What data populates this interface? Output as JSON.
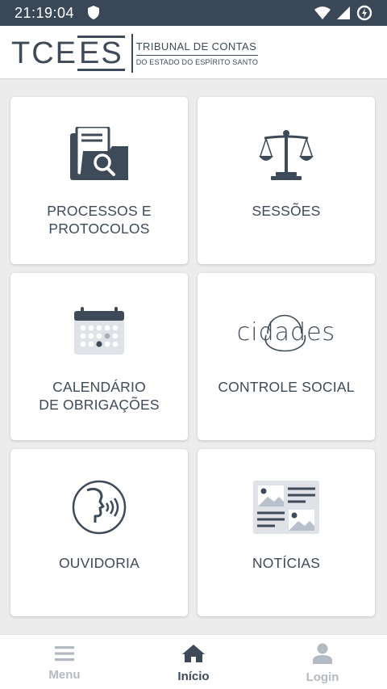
{
  "status_bar": {
    "time": "21:19:04"
  },
  "header": {
    "logo_mark_left": "TCE",
    "logo_mark_right": "ES",
    "logo_line1": "TRIBUNAL DE CONTAS",
    "logo_line2": "DO ESTADO DO ESPÍRITO SANTO"
  },
  "tiles": [
    {
      "label": "PROCESSOS E\nPROTOCOLOS",
      "icon": "document-search-icon"
    },
    {
      "label": "SESSÕES",
      "icon": "scales-icon"
    },
    {
      "label": "CALENDÁRIO\nDE OBRIGAÇÕES",
      "icon": "calendar-icon"
    },
    {
      "label": "CONTROLE SOCIAL",
      "icon": "cidades-logo"
    },
    {
      "label": "OUVIDORIA",
      "icon": "speaking-head-icon"
    },
    {
      "label": "NOTÍCIAS",
      "icon": "newspaper-icon"
    }
  ],
  "cidades_text": "cidades",
  "bottom_nav": {
    "menu": "Menu",
    "inicio": "Início",
    "login": "Login"
  },
  "colors": {
    "primary": "#3e4a57",
    "inactive": "#b4bac2",
    "status_bar": "#3a4756",
    "background": "#ececec"
  }
}
